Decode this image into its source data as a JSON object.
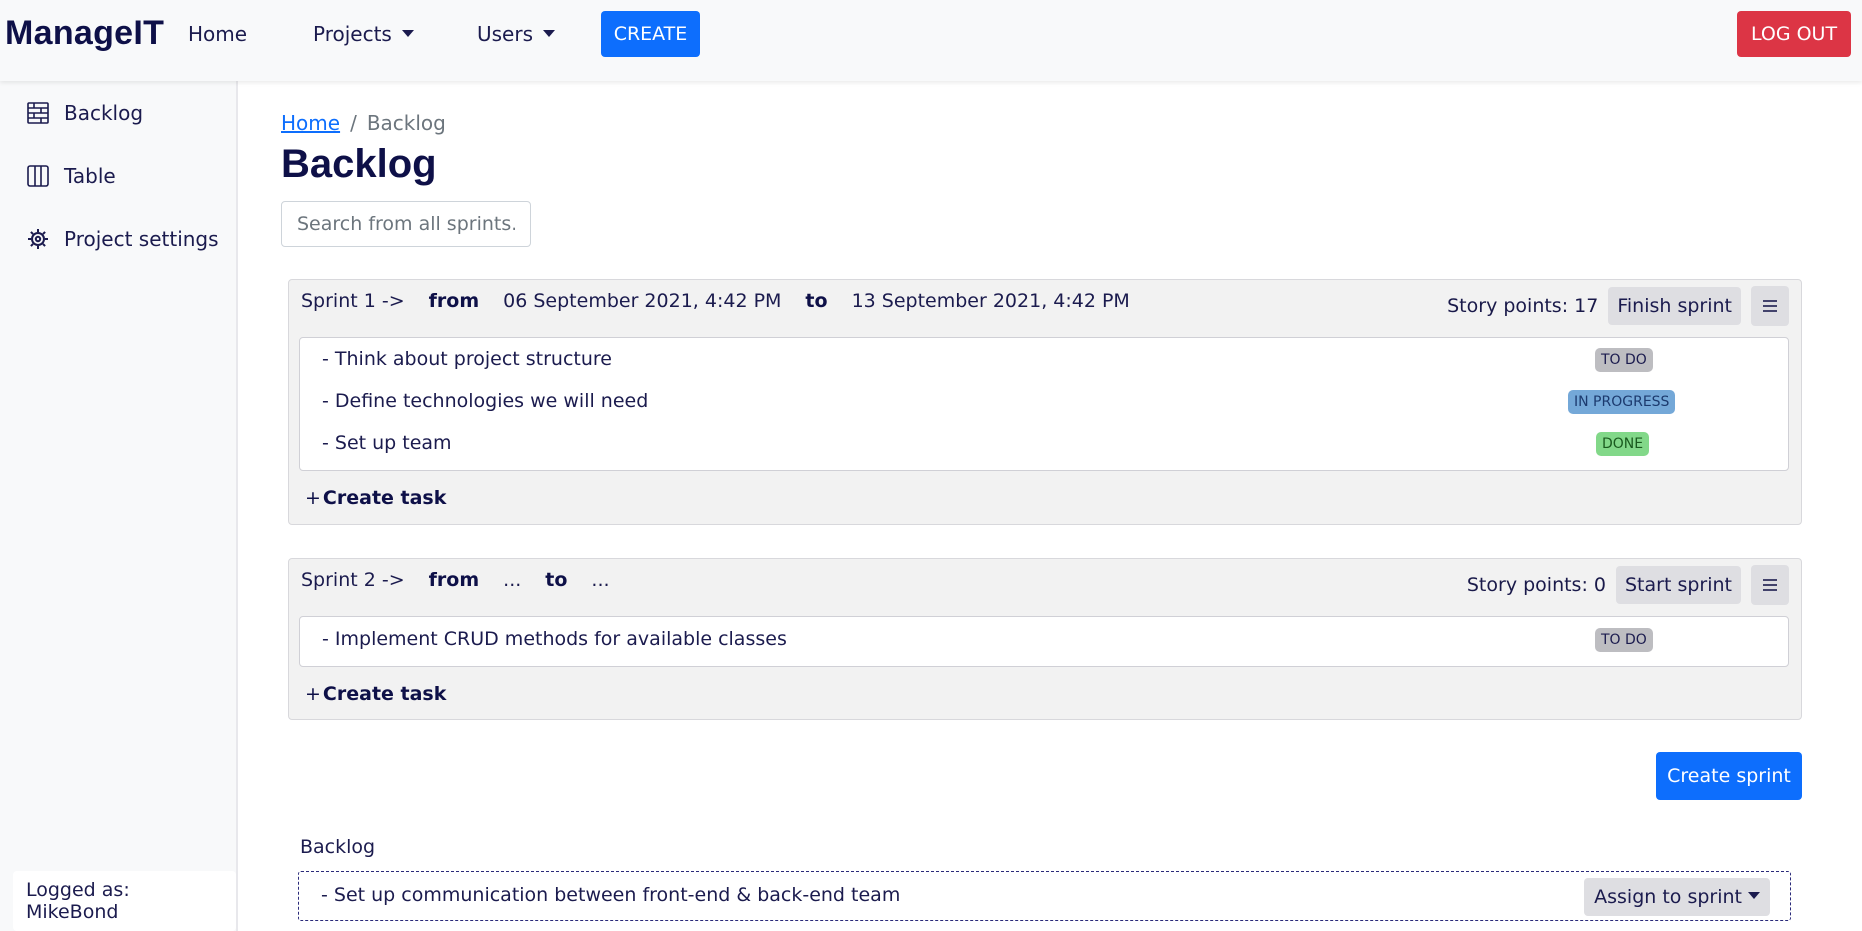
{
  "navbar": {
    "brand": "ManageIT",
    "home": "Home",
    "projects": "Projects",
    "users": "Users",
    "create": "CREATE",
    "logout": "LOG OUT"
  },
  "sidebar": {
    "items": [
      {
        "label": "Backlog",
        "icon": "backlog-icon"
      },
      {
        "label": "Table",
        "icon": "columns-icon"
      },
      {
        "label": "Project settings",
        "icon": "gear-icon"
      }
    ],
    "logged_as": "Logged as: MikeBond"
  },
  "breadcrumb": {
    "home": "Home",
    "separator": "/",
    "current": "Backlog"
  },
  "page_title": "Backlog",
  "search": {
    "placeholder": "Search from all sprints.",
    "value": ""
  },
  "sprints": [
    {
      "name": "Sprint 1 ->",
      "from_label": "from",
      "from": "06 September 2021, 4:42 PM",
      "to_label": "to",
      "to": "13 September 2021, 4:42 PM",
      "story_points": "Story points: 17",
      "action": "Finish sprint",
      "tasks": [
        {
          "title": "- Think about project structure",
          "status": "TO DO"
        },
        {
          "title": "- Define technologies we will need",
          "status": "IN PROGRESS"
        },
        {
          "title": "- Set up team",
          "status": "DONE"
        }
      ],
      "create_task": "Create task"
    },
    {
      "name": "Sprint 2 ->",
      "from_label": "from",
      "from": "...",
      "to_label": "to",
      "to": "...",
      "story_points": "Story points: 0",
      "action": "Start sprint",
      "tasks": [
        {
          "title": "- Implement CRUD methods for available classes",
          "status": "TO DO"
        }
      ],
      "create_task": "Create task"
    }
  ],
  "create_sprint": "Create sprint",
  "backlog": {
    "label": "Backlog",
    "tasks": [
      {
        "title": "- Set up communication between front-end & back-end team",
        "action": "Assign to sprint"
      }
    ]
  },
  "colors": {
    "primary": "#0d6efd",
    "danger": "#dc3545",
    "brand_text": "#0e1048",
    "badge_todo": "#bdbdc1",
    "badge_in_progress": "#74a8d8",
    "badge_done": "#82d889"
  }
}
